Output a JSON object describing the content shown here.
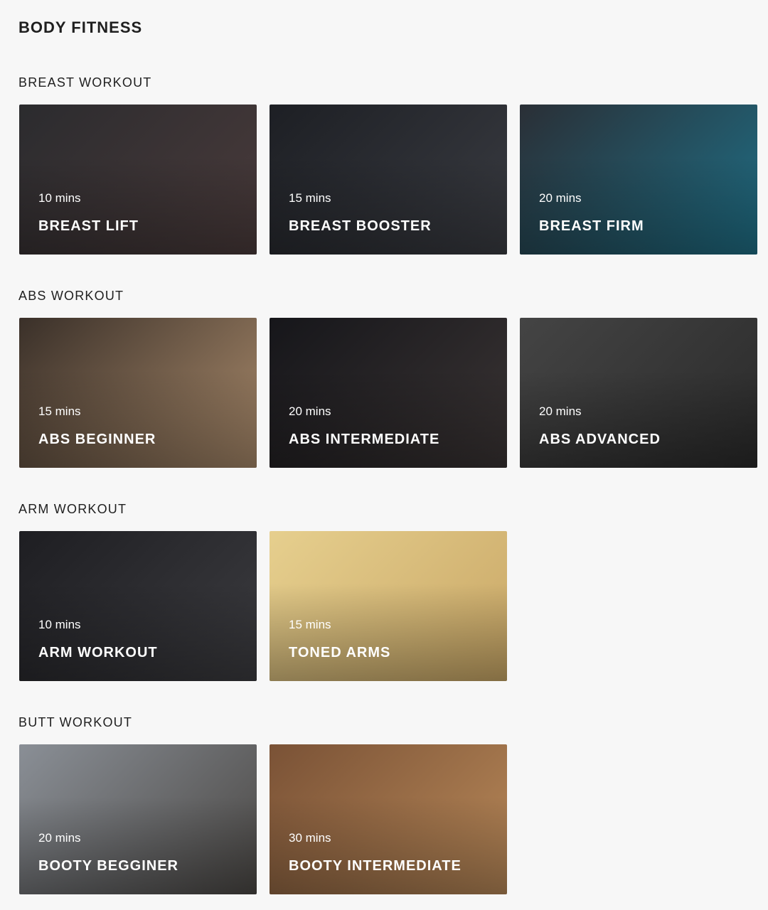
{
  "page": {
    "title": "BODY FITNESS"
  },
  "sections": [
    {
      "title": "BREAST WORKOUT",
      "cards": [
        {
          "duration": "10 mins",
          "name": "BREAST LIFT"
        },
        {
          "duration": "15 mins",
          "name": "BREAST BOOSTER"
        },
        {
          "duration": "20 mins",
          "name": "BREAST FIRM"
        }
      ]
    },
    {
      "title": "ABS WORKOUT",
      "cards": [
        {
          "duration": "15 mins",
          "name": "ABS BEGINNER"
        },
        {
          "duration": "20 mins",
          "name": "ABS INTERMEDIATE"
        },
        {
          "duration": "20 mins",
          "name": "ABS ADVANCED"
        }
      ]
    },
    {
      "title": "ARM WORKOUT",
      "cards": [
        {
          "duration": "10 mins",
          "name": "ARM WORKOUT"
        },
        {
          "duration": "15 mins",
          "name": "TONED ARMS"
        }
      ]
    },
    {
      "title": "BUTT WORKOUT",
      "cards": [
        {
          "duration": "20 mins",
          "name": "BOOTY BEGGINER"
        },
        {
          "duration": "30 mins",
          "name": "BOOTY INTERMEDIATE"
        }
      ]
    }
  ]
}
